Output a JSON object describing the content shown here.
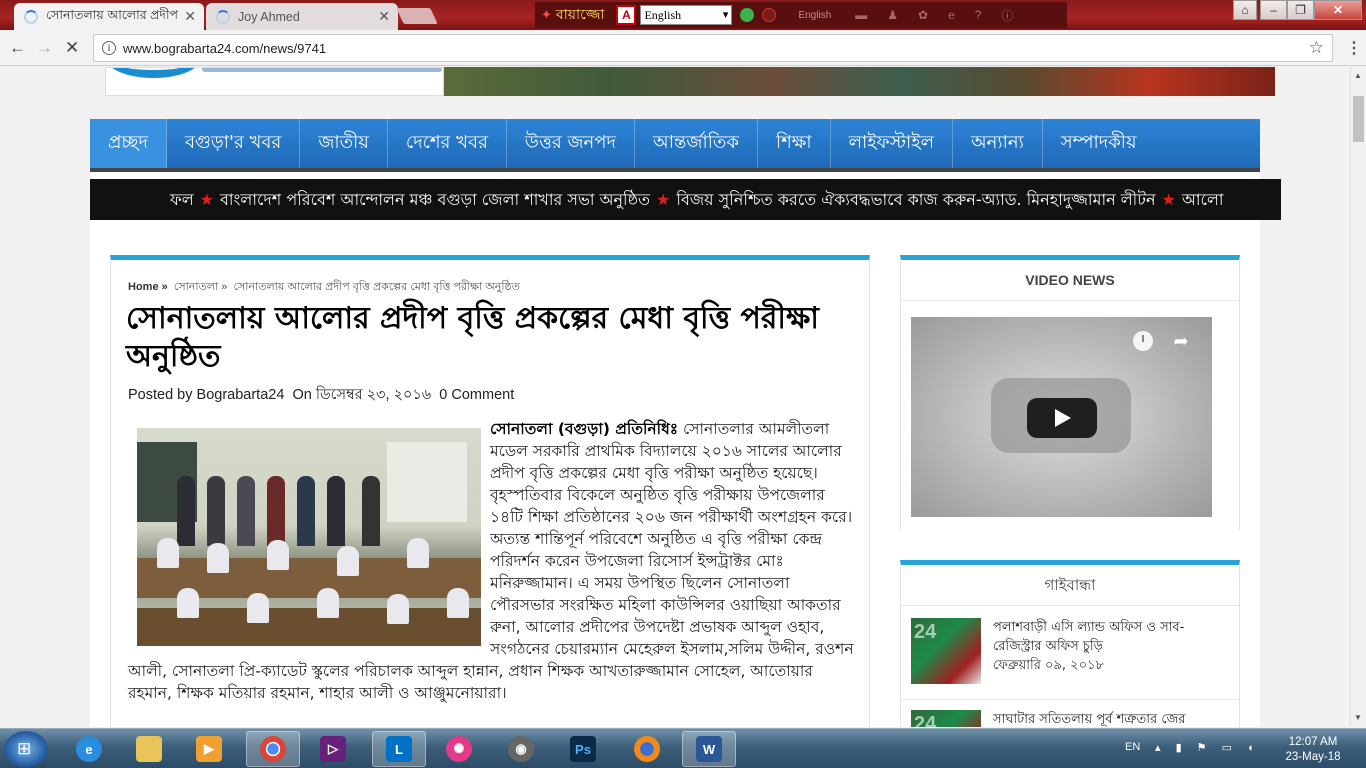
{
  "browser": {
    "tabs": [
      {
        "label": "সোনাতলায় আলোর প্রদীপ"
      },
      {
        "label": "Joy Ahmed"
      }
    ],
    "url": "www.bograbarta24.com/news/9741",
    "ime": {
      "name": "বিজয়",
      "name_display": "বায়াজ্জো",
      "language": "English",
      "status": "English"
    }
  },
  "site": {
    "nav": [
      "প্রচ্ছদ",
      "বগুড়া'র খবর",
      "জাতীয়",
      "দেশের খবর",
      "উত্তর জনপদ",
      "আন্তর্জাতিক",
      "শিক্ষা",
      "লাইফস্টাইল",
      "অন্যান্য",
      "সম্পাদকীয়"
    ],
    "ticker": [
      "ফল",
      "বাংলাদেশ পরিবেশ আন্দোলন মঞ্চ বগুড়া জেলা শাখার সভা অনুষ্ঠিত",
      "বিজয় সুনিশ্চিত করতে ঐক্যবদ্ধভাবে কাজ করুন-অ্যাড. মিনহাদুজ্জামান লীটন",
      "আলো"
    ]
  },
  "article": {
    "breadcrumb": {
      "home": "Home",
      "sep": "»",
      "category": "সোনাতলা",
      "current": "সোনাতলায় আলোর প্রদীপ বৃত্তি প্রকল্পের মেধা বৃত্তি পরীক্ষা অনুষ্ঠিত"
    },
    "headline": "সোনাতলায় আলোর প্রদীপ বৃত্তি প্রকল্পের মেধা বৃত্তি পরীক্ষা অনুষ্ঠিত",
    "meta": {
      "posted_by_label": "Posted by",
      "author": "Bograbarta24",
      "on_label": "On",
      "date": "ডিসেম্বর ২৩, ২০১৬",
      "comments": "0 Comment"
    },
    "lead": "সোনাতলা (বগুড়া) প্রতিনিধিঃ",
    "body": "সোনাতলার আমলীতলা মডেল সরকারি প্রাথমিক বিদ্যালয়ে ২০১৬ সালের আলোর প্রদীপ বৃত্তি প্রকল্পের মেধা বৃত্তি পরীক্ষা অনুষ্ঠিত হয়েছে। বৃহস্পতিবার বিকেলে অনুষ্ঠিত বৃত্তি পরীক্ষায় উপজেলার ১৪টি শিক্ষা প্রতিষ্ঠানের ২০৬ জন পরীক্ষার্থী অংশগ্রহন করে। অত্যন্ত শান্তিপূর্ন পরিবেশে অনুষ্ঠিত এ বৃত্তি পরীক্ষা কেন্দ্র পরিদর্শন করেন উপজেলা রিসোর্স ইন্সট্রাক্টর মোঃ মনিরুজ্জামান। এ সময় উপস্থিত ছিলেন সোনাতলা পৌরসভার সংরক্ষিত মহিলা কাউন্সিলর ওয়াছিয়া আকতার রুনা, আলোর প্রদীপের উপদেষ্টা প্রভাষক আব্দুল ওহাব, সংগঠনের চেয়ারম্যান মেহেরুল ইসলাম,সলিম উদ্দীন, রওশন আলী, সোনাতলা প্রি-ক্যাডেট স্কুলের পরিচালক আব্দুল হান্নান, প্রধান শিক্ষক আখতারুজ্জামান সোহেল, আতোয়ার রহমান, শিক্ষক মতিয়ার রহমান, শাহার আলী ও আঞ্জুমনোয়ারা।"
  },
  "sidebar": {
    "video_title": "VIDEO NEWS",
    "district_title": "গাইবান্ধা",
    "news": [
      {
        "title": "পলাশবাড়ী এসি ল্যান্ড অফিস ও সাব-রেজিস্ট্রার অফিস চুড়ি",
        "date": "ফেব্রুয়ারি ০৯, ২০১৮"
      },
      {
        "title": "সাঘাটার সতিতলায় পূর্ব শত্রুতার জের",
        "date": ""
      }
    ]
  },
  "taskbar": {
    "lang": "EN",
    "time": "12:07 AM",
    "date": "23-May-18"
  },
  "icons": [
    "reload-icon",
    "back-icon",
    "forward-icon",
    "star-icon",
    "menu-icon",
    "play-icon",
    "clock-icon",
    "share-icon"
  ]
}
